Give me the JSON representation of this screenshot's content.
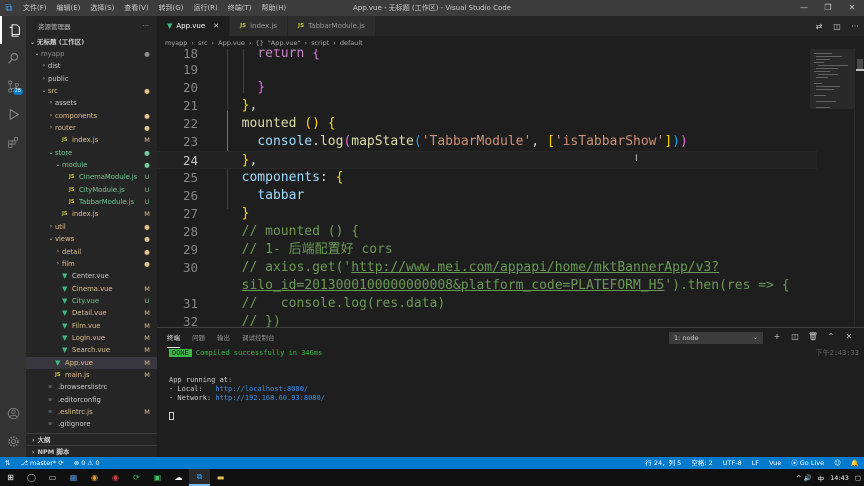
{
  "window": {
    "title": "App.vue - 无标题 (工作区) - Visual Studio Code",
    "menu": [
      "文件(F)",
      "编辑(E)",
      "选择(S)",
      "查看(V)",
      "转到(G)",
      "运行(R)",
      "终端(T)",
      "帮助(H)"
    ],
    "controls": {
      "minimize": "—",
      "restore": "❐",
      "close": "✕"
    }
  },
  "activity": {
    "scm_badge": "28"
  },
  "sidebar": {
    "header": "资源管理器",
    "more": "···",
    "workspace": "无标题 (工作区)",
    "items": [
      {
        "name": "myapp",
        "kind": "folder-open",
        "depth": 1,
        "status": "●",
        "sc": "c-gray"
      },
      {
        "name": "dist",
        "kind": "folder",
        "depth": 2,
        "status": "",
        "sc": "c-def"
      },
      {
        "name": "public",
        "kind": "folder",
        "depth": 2,
        "status": "",
        "sc": "c-def"
      },
      {
        "name": "src",
        "kind": "folder-open",
        "depth": 2,
        "status": "●",
        "sc": "c-mod"
      },
      {
        "name": "assets",
        "kind": "folder",
        "depth": 3,
        "status": "",
        "sc": "c-def"
      },
      {
        "name": "components",
        "kind": "folder",
        "depth": 3,
        "status": "●",
        "sc": "c-mod"
      },
      {
        "name": "router",
        "kind": "folder",
        "depth": 3,
        "status": "●",
        "sc": "c-mod"
      },
      {
        "name": "index.js",
        "kind": "js",
        "depth": 4,
        "status": "M",
        "sc": "c-mod"
      },
      {
        "name": "store",
        "kind": "folder-open",
        "depth": 3,
        "status": "●",
        "sc": "c-unt"
      },
      {
        "name": "module",
        "kind": "folder-open",
        "depth": 4,
        "status": "●",
        "sc": "c-unt"
      },
      {
        "name": "CinemaModule.js",
        "kind": "js",
        "depth": 5,
        "status": "U",
        "sc": "c-unt"
      },
      {
        "name": "CityModule.js",
        "kind": "js",
        "depth": 5,
        "status": "U",
        "sc": "c-unt"
      },
      {
        "name": "TabbarModule.js",
        "kind": "js",
        "depth": 5,
        "status": "U",
        "sc": "c-unt"
      },
      {
        "name": "index.js",
        "kind": "js",
        "depth": 4,
        "status": "M",
        "sc": "c-mod"
      },
      {
        "name": "util",
        "kind": "folder",
        "depth": 3,
        "status": "●",
        "sc": "c-mod"
      },
      {
        "name": "views",
        "kind": "folder-open",
        "depth": 3,
        "status": "●",
        "sc": "c-mod"
      },
      {
        "name": "detail",
        "kind": "folder",
        "depth": 4,
        "status": "●",
        "sc": "c-mod"
      },
      {
        "name": "film",
        "kind": "folder",
        "depth": 4,
        "status": "●",
        "sc": "c-mod"
      },
      {
        "name": "Center.vue",
        "kind": "vue",
        "depth": 4,
        "status": "",
        "sc": "c-def"
      },
      {
        "name": "Cinema.vue",
        "kind": "vue",
        "depth": 4,
        "status": "M",
        "sc": "c-mod"
      },
      {
        "name": "City.vue",
        "kind": "vue",
        "depth": 4,
        "status": "U",
        "sc": "c-unt"
      },
      {
        "name": "Detail.vue",
        "kind": "vue",
        "depth": 4,
        "status": "M",
        "sc": "c-mod"
      },
      {
        "name": "Film.vue",
        "kind": "vue",
        "depth": 4,
        "status": "M",
        "sc": "c-mod"
      },
      {
        "name": "Login.vue",
        "kind": "vue",
        "depth": 4,
        "status": "M",
        "sc": "c-mod"
      },
      {
        "name": "Search.vue",
        "kind": "vue",
        "depth": 4,
        "status": "M",
        "sc": "c-mod"
      },
      {
        "name": "App.vue",
        "kind": "vue",
        "depth": 3,
        "status": "M",
        "sc": "c-mod",
        "selected": true
      },
      {
        "name": "main.js",
        "kind": "js",
        "depth": 3,
        "status": "M",
        "sc": "c-mod"
      },
      {
        "name": ".browserslistrc",
        "kind": "dot",
        "depth": 2,
        "status": "",
        "sc": "c-def"
      },
      {
        "name": ".editorconfig",
        "kind": "dot",
        "depth": 2,
        "status": "",
        "sc": "c-def"
      },
      {
        "name": ".eslintrc.js",
        "kind": "dot",
        "depth": 2,
        "status": "M",
        "sc": "c-mod"
      },
      {
        "name": ".gitignore",
        "kind": "dot",
        "depth": 2,
        "status": "",
        "sc": "c-def"
      }
    ],
    "outline": "大纲",
    "npm": "NPM 脚本"
  },
  "tabs": [
    {
      "label": "App.vue",
      "icon": "V",
      "active": true,
      "close": "✕"
    },
    {
      "label": "index.js",
      "icon": "JS",
      "active": false
    },
    {
      "label": "TabbarModule.js",
      "icon": "JS",
      "active": false
    }
  ],
  "breadcrumb": [
    "myapp",
    "›",
    "src",
    "›",
    "App.vue",
    "›",
    "{}",
    "\"App.vue\"",
    "›",
    "script",
    "›",
    "default"
  ],
  "editor": {
    "lines": [
      {
        "n": "18",
        "html": "    <span class=\"k-kw\">return</span> <span class=\"k-br2\">{</span>"
      },
      {
        "n": "19",
        "html": ""
      },
      {
        "n": "20",
        "html": "    <span class=\"k-br2\">}</span>"
      },
      {
        "n": "21",
        "html": "  <span class=\"k-br1\">}</span>,"
      },
      {
        "n": "22",
        "html": "  <span class=\"k-fn\">mounted</span> <span class=\"k-br1\">()</span> <span class=\"k-br1\">{</span>"
      },
      {
        "n": "23",
        "html": "    <span class=\"k-prop\">console</span>.<span class=\"k-fn\">log</span><span class=\"k-br2\">(</span><span class=\"k-fn\">mapState</span><span class=\"k-br3\">(</span><span class=\"k-str\">'TabbarModule'</span>, <span class=\"k-br1\">[</span><span class=\"k-str\">'isTabbarShow'</span><span class=\"k-br1\">]</span><span class=\"k-br3\">)</span><span class=\"k-br2\">)</span>"
      },
      {
        "n": "24",
        "html": "  <span class=\"k-br1\">}</span>,",
        "current": true
      },
      {
        "n": "25",
        "html": "  <span class=\"k-prop\">components</span>: <span class=\"k-br1\">{</span>"
      },
      {
        "n": "26",
        "html": "    <span class=\"k-prop\">tabbar</span>"
      },
      {
        "n": "27",
        "html": "  <span class=\"k-br1\">}</span>"
      },
      {
        "n": "28",
        "html": "  <span class=\"k-cmt\">// mounted () {</span>"
      },
      {
        "n": "29",
        "html": "  <span class=\"k-cmt\">// 1- 后端配置好 cors</span>"
      },
      {
        "n": "30",
        "html": "  <span class=\"k-cmt\">// axios.get('<span class=\"k-link\">http://www.mei.com/appapi/home/mktBannerApp/v3?</span></span>"
      },
      {
        "n": "",
        "html": "  <span class=\"k-cmt\"><span class=\"k-link\">silo_id=2013000100000000008&amp;platform_code=PLATEFORM_H5</span>').then(res =&gt; {</span>"
      },
      {
        "n": "31",
        "html": "  <span class=\"k-cmt\">//   console.log(res.data)</span>"
      },
      {
        "n": "32",
        "html": "  <span class=\"k-cmt\">// })</span>"
      }
    ]
  },
  "panel": {
    "tabs": [
      "终端",
      "问题",
      "输出",
      "调试控制台"
    ],
    "terminal_select": "1: node",
    "buttons": [
      "+",
      "◫",
      "🗑",
      "⌃",
      "✕"
    ],
    "done_badge": "DONE",
    "compiled": "Compiled successfully in 346ms",
    "timestamp": "下午2:43:33",
    "running": "App running at:",
    "local_label": "- Local:   ",
    "local_url": "http://localhost:8080/",
    "network_label": "- Network: ",
    "network_url": "http://192.168.60.93:8080/"
  },
  "status": {
    "branch": "master*",
    "sync": "⟳",
    "errors": "⊗ 0 ⚠ 0",
    "position": "行 24，列 5",
    "spaces": "空格: 2",
    "encoding": "UTF-8",
    "eol": "LF",
    "language": "Vue",
    "golive": "Go Live",
    "bell": "🔔"
  },
  "taskbar": {
    "time": "14:43",
    "lang": "中",
    "tray": "^  🔊"
  }
}
